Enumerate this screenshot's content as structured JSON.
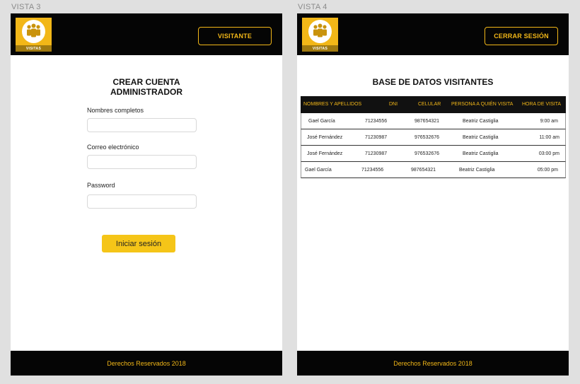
{
  "vista3": {
    "label": "VISTA 3",
    "logo_text": "VISITAS",
    "header_button": "VISITANTE",
    "form_title_line1": "CREAR CUENTA",
    "form_title_line2": "ADMINISTRADOR",
    "fields": [
      {
        "label": "Nombres completos",
        "value": ""
      },
      {
        "label": "Correo electrónico",
        "value": ""
      },
      {
        "label": "Password",
        "value": ""
      }
    ],
    "submit_label": "Iniciar sesión",
    "footer": "Derechos Reservados 2018"
  },
  "vista4": {
    "label": "VISTA 4",
    "logo_text": "VISITAS",
    "header_button": "CERRAR SESIÓN",
    "table_title": "BASE DE DATOS VISITANTES",
    "columns": [
      "NOMBRES Y APELLIDOS",
      "DNI",
      "CELULAR",
      "PERSONA A QUIÉN VISITA",
      "HORA DE VISITA"
    ],
    "rows": [
      [
        "Gael García",
        "71234556",
        "987654321",
        "Beatriz Castiglia",
        "9:00 am"
      ],
      [
        "José Fernández",
        "71230987",
        "976532676",
        "Beatriz Castiglia",
        "11:00 am"
      ],
      [
        "José Fernández",
        "71230987",
        "976532676",
        "Beatriz Castiglia",
        "03:00 pm"
      ],
      [
        "Gael García",
        "71234556",
        "987654321",
        "Beatriz Castiglia",
        "05:00 pm"
      ]
    ],
    "footer": "Derechos Reservados 2018"
  },
  "colors": {
    "accent": "#f2b718",
    "header_bg": "#050505",
    "button_fill": "#f5c518"
  },
  "icons": {
    "logo": "group-of-people-icon"
  }
}
